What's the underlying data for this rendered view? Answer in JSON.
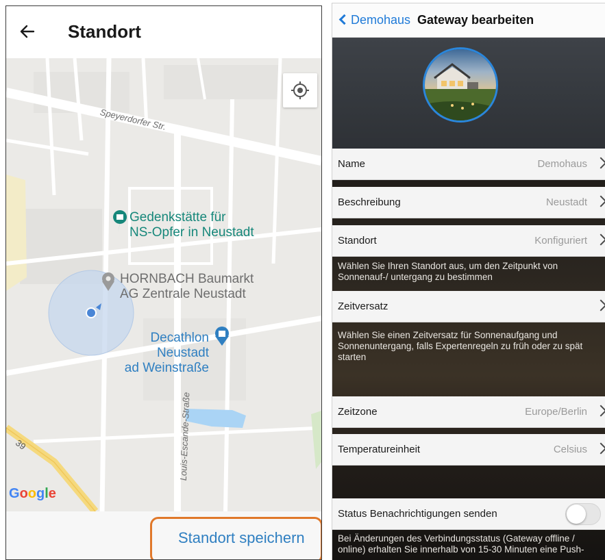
{
  "left": {
    "header": {
      "title": "Standort"
    },
    "map": {
      "pois": [
        {
          "name": "Gedenkstätte für NS-Opfer in Neustadt",
          "line1": "Gedenkstätte für",
          "line2": "NS-Opfer in Neustadt"
        },
        {
          "name": "HORNBACH Baumarkt AG Zentrale Neustadt",
          "line1": "HORNBACH Baumarkt",
          "line2": "AG Zentrale Neustadt"
        },
        {
          "name": "Decathlon Neustadt ad Weinstraße",
          "line1": "Decathlon Neustadt",
          "line2": "ad Weinstraße"
        }
      ],
      "streets": {
        "speyerdorfer": "Speyerdorfer Str.",
        "louis": "Louis-Escande-Straße",
        "road_number": "39"
      },
      "google": {
        "G": "G",
        "o1": "o",
        "o2": "o",
        "g": "g",
        "l": "l",
        "e": "e"
      }
    },
    "footer": {
      "save_label": "Standort speichern"
    }
  },
  "right": {
    "nav": {
      "back_label": "Demohaus",
      "title": "Gateway bearbeiten"
    },
    "rows": {
      "name": {
        "label": "Name",
        "value": "Demohaus"
      },
      "beschreibung": {
        "label": "Beschreibung",
        "value": "Neustadt"
      },
      "standort": {
        "label": "Standort",
        "value": "Konfiguriert"
      },
      "zeitversatz": {
        "label": "Zeitversatz",
        "value": ""
      },
      "zeitzone": {
        "label": "Zeitzone",
        "value": "Europe/Berlin"
      },
      "temperatur": {
        "label": "Temperatureinheit",
        "value": "Celsius"
      },
      "status": {
        "label": "Status Benachrichtigungen senden",
        "toggle_on": false
      }
    },
    "hints": {
      "standort": "Wählen Sie Ihren Standort aus, um den Zeitpunkt von Sonnenauf-/ untergang zu bestimmen",
      "zeitversatz": "Wählen Sie einen Zeitversatz für Sonnenaufgang und Sonnenuntergang, falls Expertenregeln zu früh oder zu spät starten",
      "status": "Bei Änderungen des Verbindungsstatus (Gateway offline / online) erhalten Sie innerhalb von 15-30 Minuten eine Push-"
    }
  },
  "colors": {
    "accent_blue": "#2f7fc1",
    "ios_blue": "#1f7ad8",
    "highlight_orange": "#e0782a",
    "map_teal": "#16877a"
  }
}
